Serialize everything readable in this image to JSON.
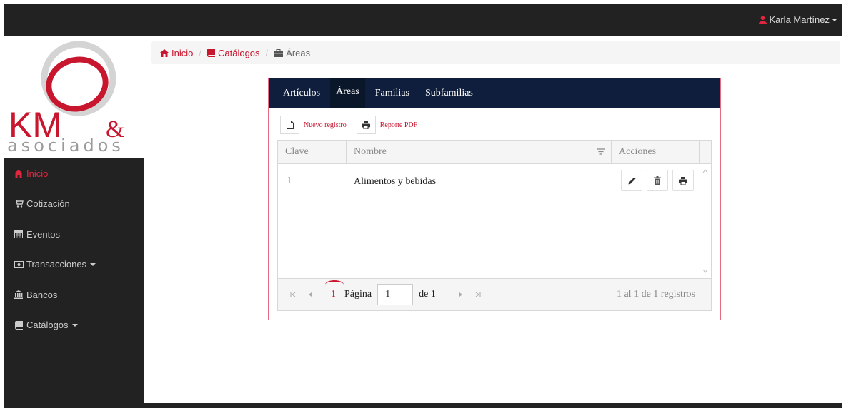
{
  "user": {
    "name": "Karla Martínez"
  },
  "logo": {
    "text": "asociados",
    "brand_color": "#c9162f"
  },
  "sidebar": {
    "items": [
      {
        "label": "Inicio",
        "icon": "home-icon"
      },
      {
        "label": "Cotización",
        "icon": "cart-icon"
      },
      {
        "label": "Eventos",
        "icon": "calendar-icon"
      },
      {
        "label": "Transacciones",
        "icon": "money-icon"
      },
      {
        "label": "Bancos",
        "icon": "bank-icon"
      },
      {
        "label": "Catálogos",
        "icon": "book-icon"
      }
    ]
  },
  "breadcrumb": {
    "items": [
      {
        "label": "Inicio",
        "icon": "home-icon"
      },
      {
        "label": "Catálogos",
        "icon": "book-icon"
      },
      {
        "label": "Áreas",
        "icon": "briefcase-icon"
      }
    ]
  },
  "tabs": [
    {
      "label": "Artículos",
      "active": false
    },
    {
      "label": "Áreas",
      "active": true
    },
    {
      "label": "Familias",
      "active": false
    },
    {
      "label": "Subfamilias",
      "active": false
    }
  ],
  "toolbar": {
    "new_label": "Nuevo registro",
    "pdf_label": "Reporte PDF"
  },
  "grid": {
    "columns": [
      "Clave",
      "Nombre",
      "Acciones"
    ],
    "rows": [
      {
        "clave": "1",
        "nombre": "Alimentos y bebidas"
      }
    ]
  },
  "pager": {
    "current_page": "1",
    "page_label": "Página",
    "page_value": "1",
    "of_label": "de 1",
    "info": "1 al 1 de 1 registros"
  },
  "colors": {
    "accent": "#c9162f",
    "tabbar": "#0e1e3c",
    "dark": "#222222"
  }
}
